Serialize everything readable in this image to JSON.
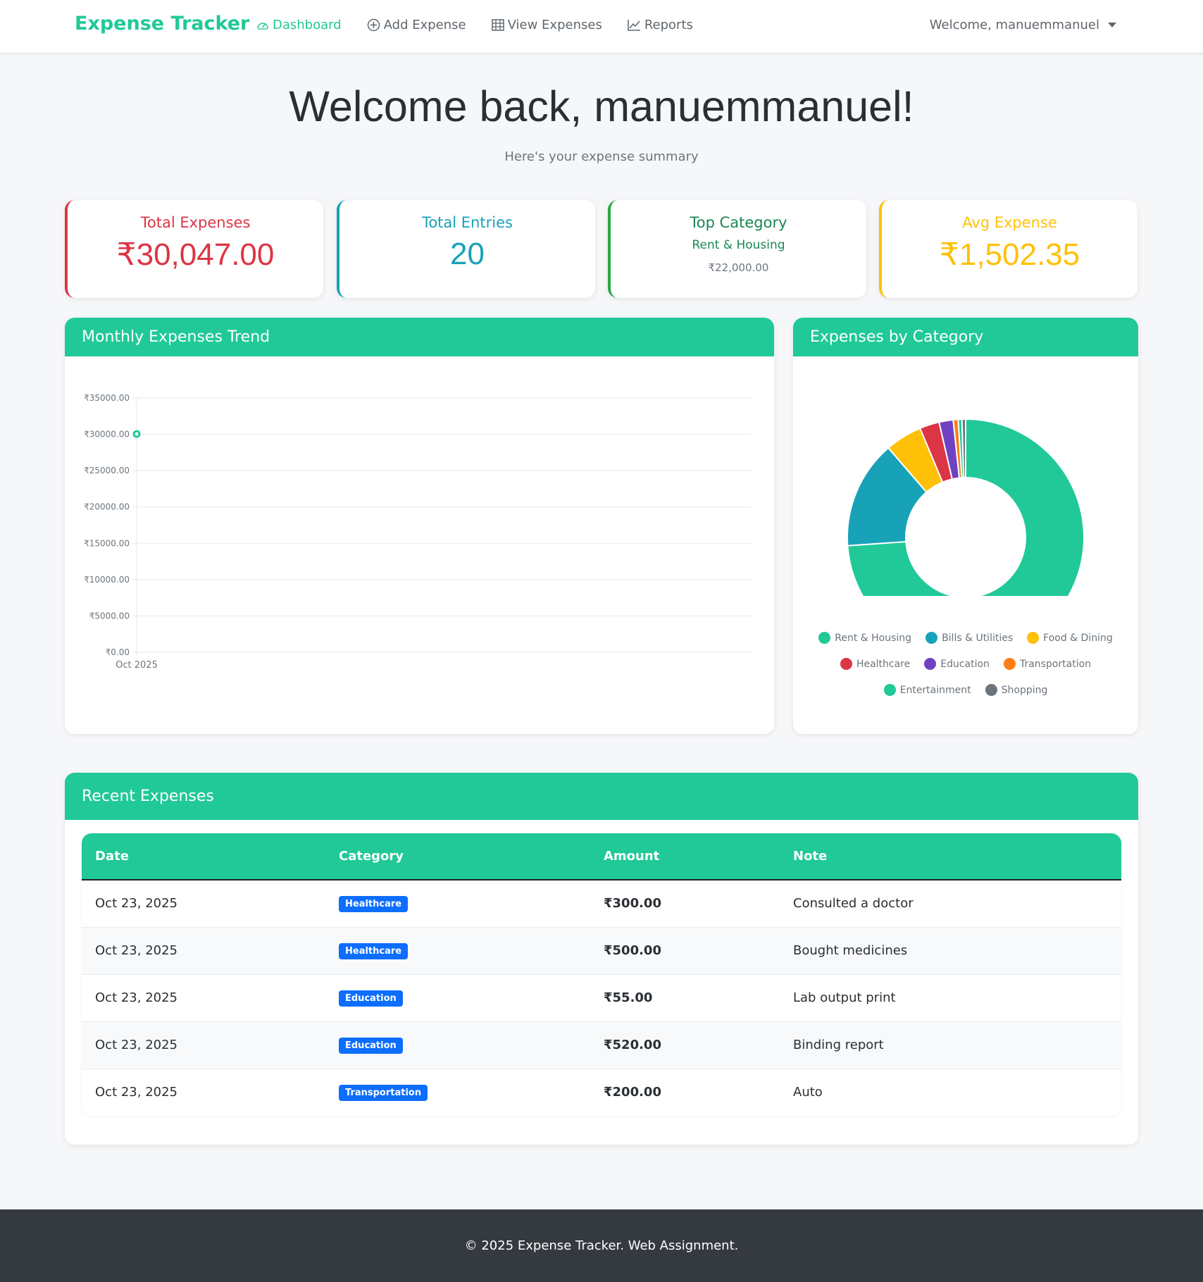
{
  "nav": {
    "brand": "Expense Tracker",
    "links": [
      "Dashboard",
      "Add Expense",
      "View Expenses",
      "Reports"
    ],
    "user": "Welcome, manuemmanuel"
  },
  "hero": {
    "title": "Welcome back, manuemmanuel!",
    "subtitle": "Here's your expense summary"
  },
  "stats": {
    "total_expenses": {
      "label": "Total Expenses",
      "value": "₹30,047.00",
      "color": "#dc3545"
    },
    "total_entries": {
      "label": "Total Entries",
      "value": "20",
      "color": "#17a2b8"
    },
    "top_category": {
      "label": "Top Category",
      "name": "Rent & Housing",
      "amount": "₹22,000.00",
      "color": "#198754"
    },
    "avg_expense": {
      "label": "Avg Expense",
      "value": "₹1,502.35",
      "color": "#ffc107"
    }
  },
  "trend": {
    "title": "Monthly Expenses Trend"
  },
  "category": {
    "title": "Expenses by Category"
  },
  "chart_data": [
    {
      "type": "line",
      "title": "Monthly Expenses Trend",
      "x": [
        "Oct 2025"
      ],
      "series": [
        {
          "values": [
            30047
          ]
        }
      ],
      "yticks": [
        "₹35000.00",
        "₹30000.00",
        "₹25000.00",
        "₹20000.00",
        "₹15000.00",
        "₹10000.00",
        "₹5000.00",
        "₹0.00"
      ],
      "ylim": [
        0,
        35000
      ],
      "color": "#20c997",
      "grid": true
    },
    {
      "type": "pie",
      "title": "Expenses by Category",
      "categories": [
        "Rent & Housing",
        "Bills & Utilities",
        "Food & Dining",
        "Healthcare",
        "Education",
        "Transportation",
        "Entertainment",
        "Shopping"
      ],
      "values": [
        22000,
        4400,
        1500,
        800,
        575,
        200,
        150,
        150
      ],
      "colors": [
        "#20c997",
        "#17a2b8",
        "#ffc107",
        "#dc3545",
        "#6f42c1",
        "#fd7e14",
        "#20c997",
        "#6c757d"
      ],
      "legend": "bottom"
    }
  ],
  "recent": {
    "title": "Recent Expenses",
    "headers": [
      "Date",
      "Category",
      "Amount",
      "Note"
    ],
    "rows": [
      {
        "date": "Oct 23, 2025",
        "category": "Healthcare",
        "amount": "₹300.00",
        "note": "Consulted a doctor"
      },
      {
        "date": "Oct 23, 2025",
        "category": "Healthcare",
        "amount": "₹500.00",
        "note": "Bought medicines"
      },
      {
        "date": "Oct 23, 2025",
        "category": "Education",
        "amount": "₹55.00",
        "note": "Lab output print"
      },
      {
        "date": "Oct 23, 2025",
        "category": "Education",
        "amount": "₹520.00",
        "note": "Binding report"
      },
      {
        "date": "Oct 23, 2025",
        "category": "Transportation",
        "amount": "₹200.00",
        "note": "Auto"
      }
    ]
  },
  "footer": "© 2025 Expense Tracker. Web Assignment."
}
